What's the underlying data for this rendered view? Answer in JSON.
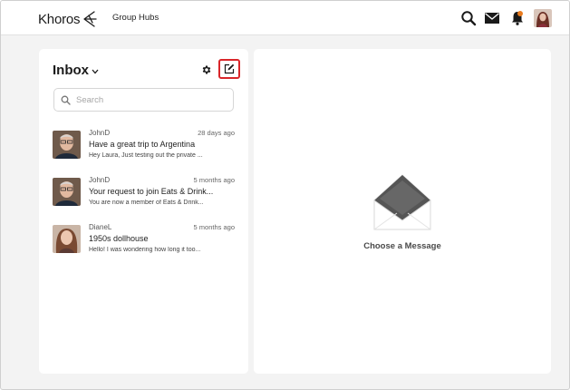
{
  "header": {
    "logo_text": "Khoros",
    "nav_link": "Group Hubs",
    "icons": [
      "search-icon",
      "mail-icon",
      "bell-icon",
      "user-avatar"
    ],
    "notification_dot_color": "#e97b1f"
  },
  "inbox": {
    "title": "Inbox",
    "search": {
      "placeholder": "Search",
      "value": ""
    },
    "compose_highlight_color": "#d9262a",
    "messages": [
      {
        "user": "JohnD",
        "time": "28 days ago",
        "subject": "Have a great trip to Argentina",
        "preview": "Hey Laura, Just testing out the private ..."
      },
      {
        "user": "JohnD",
        "time": "5 months ago",
        "subject": "Your request to join Eats & Drink...",
        "preview": "You are now a member of Eats & Drink..."
      },
      {
        "user": "DianeL",
        "time": "5 months ago",
        "subject": "1950s dollhouse",
        "preview": "Hello! I was wondering how long it too..."
      }
    ]
  },
  "detail": {
    "empty_text": "Choose a Message"
  }
}
